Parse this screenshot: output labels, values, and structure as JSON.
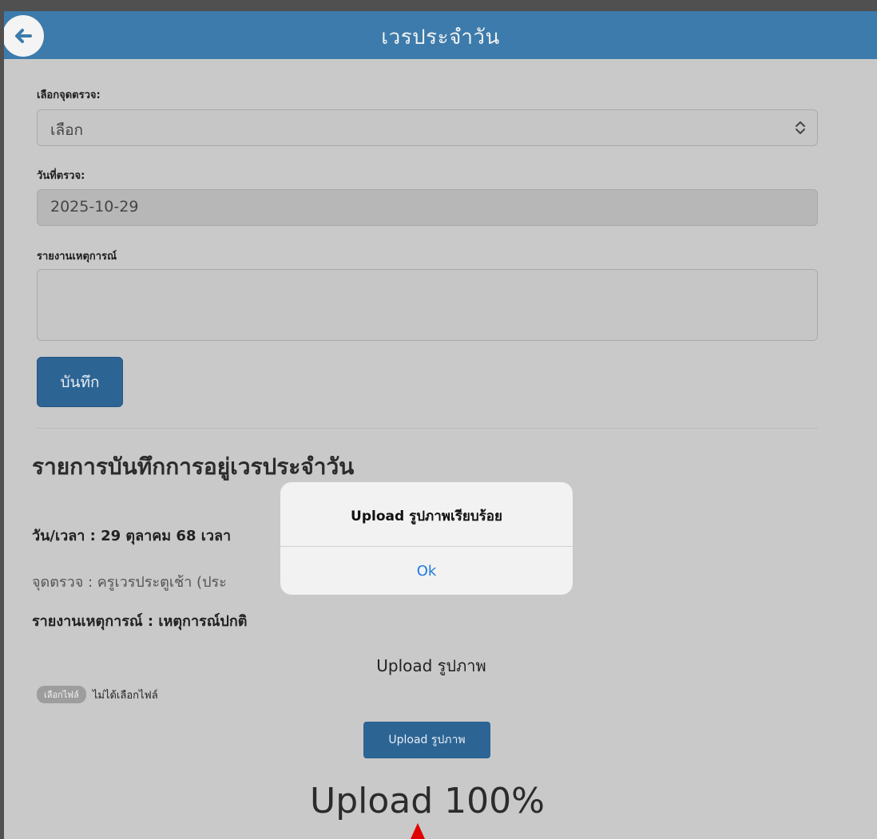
{
  "header": {
    "title": "เวรประจำวัน"
  },
  "form": {
    "checkpoint_label": "เลือกจุดตรวจ:",
    "checkpoint_value": "เลือก",
    "date_label": "วันที่ตรวจ:",
    "date_value": "2025-10-29",
    "report_label": "รายงานเหตุการณ์",
    "report_value": "",
    "save_label": "บันทึก"
  },
  "records": {
    "title": "รายการบันทึกการอยู่เวรประจำวัน",
    "datetime": "วัน/เวลา : 29 ตุลาคม 68 เวลา",
    "checkpoint": "จุดตรวจ : ครูเวรประตูเช้า (ประ",
    "report": "รายงานเหตุการณ์ : เหตุการณ์ปกติ"
  },
  "upload": {
    "heading": "Upload รูปภาพ",
    "choose_file_label": "เลือกไฟล์",
    "file_status": "ไม่ได้เลือกไฟล์",
    "button_label": "Upload รูปภาพ",
    "progress_text": "Upload 100%",
    "progress_percent": 100
  },
  "dialog": {
    "message": "Upload รูปภาพเรียบร้อย",
    "ok_label": "Ok"
  },
  "colors": {
    "header_bg": "#3c7bab",
    "primary_button": "#2c6494",
    "dialog_link": "#1f7ae0",
    "marker": "#e00000"
  },
  "icons": {
    "back": "arrow-left-icon",
    "select": "updown-chevron-icon",
    "marker": "red-triangle-pointer"
  }
}
